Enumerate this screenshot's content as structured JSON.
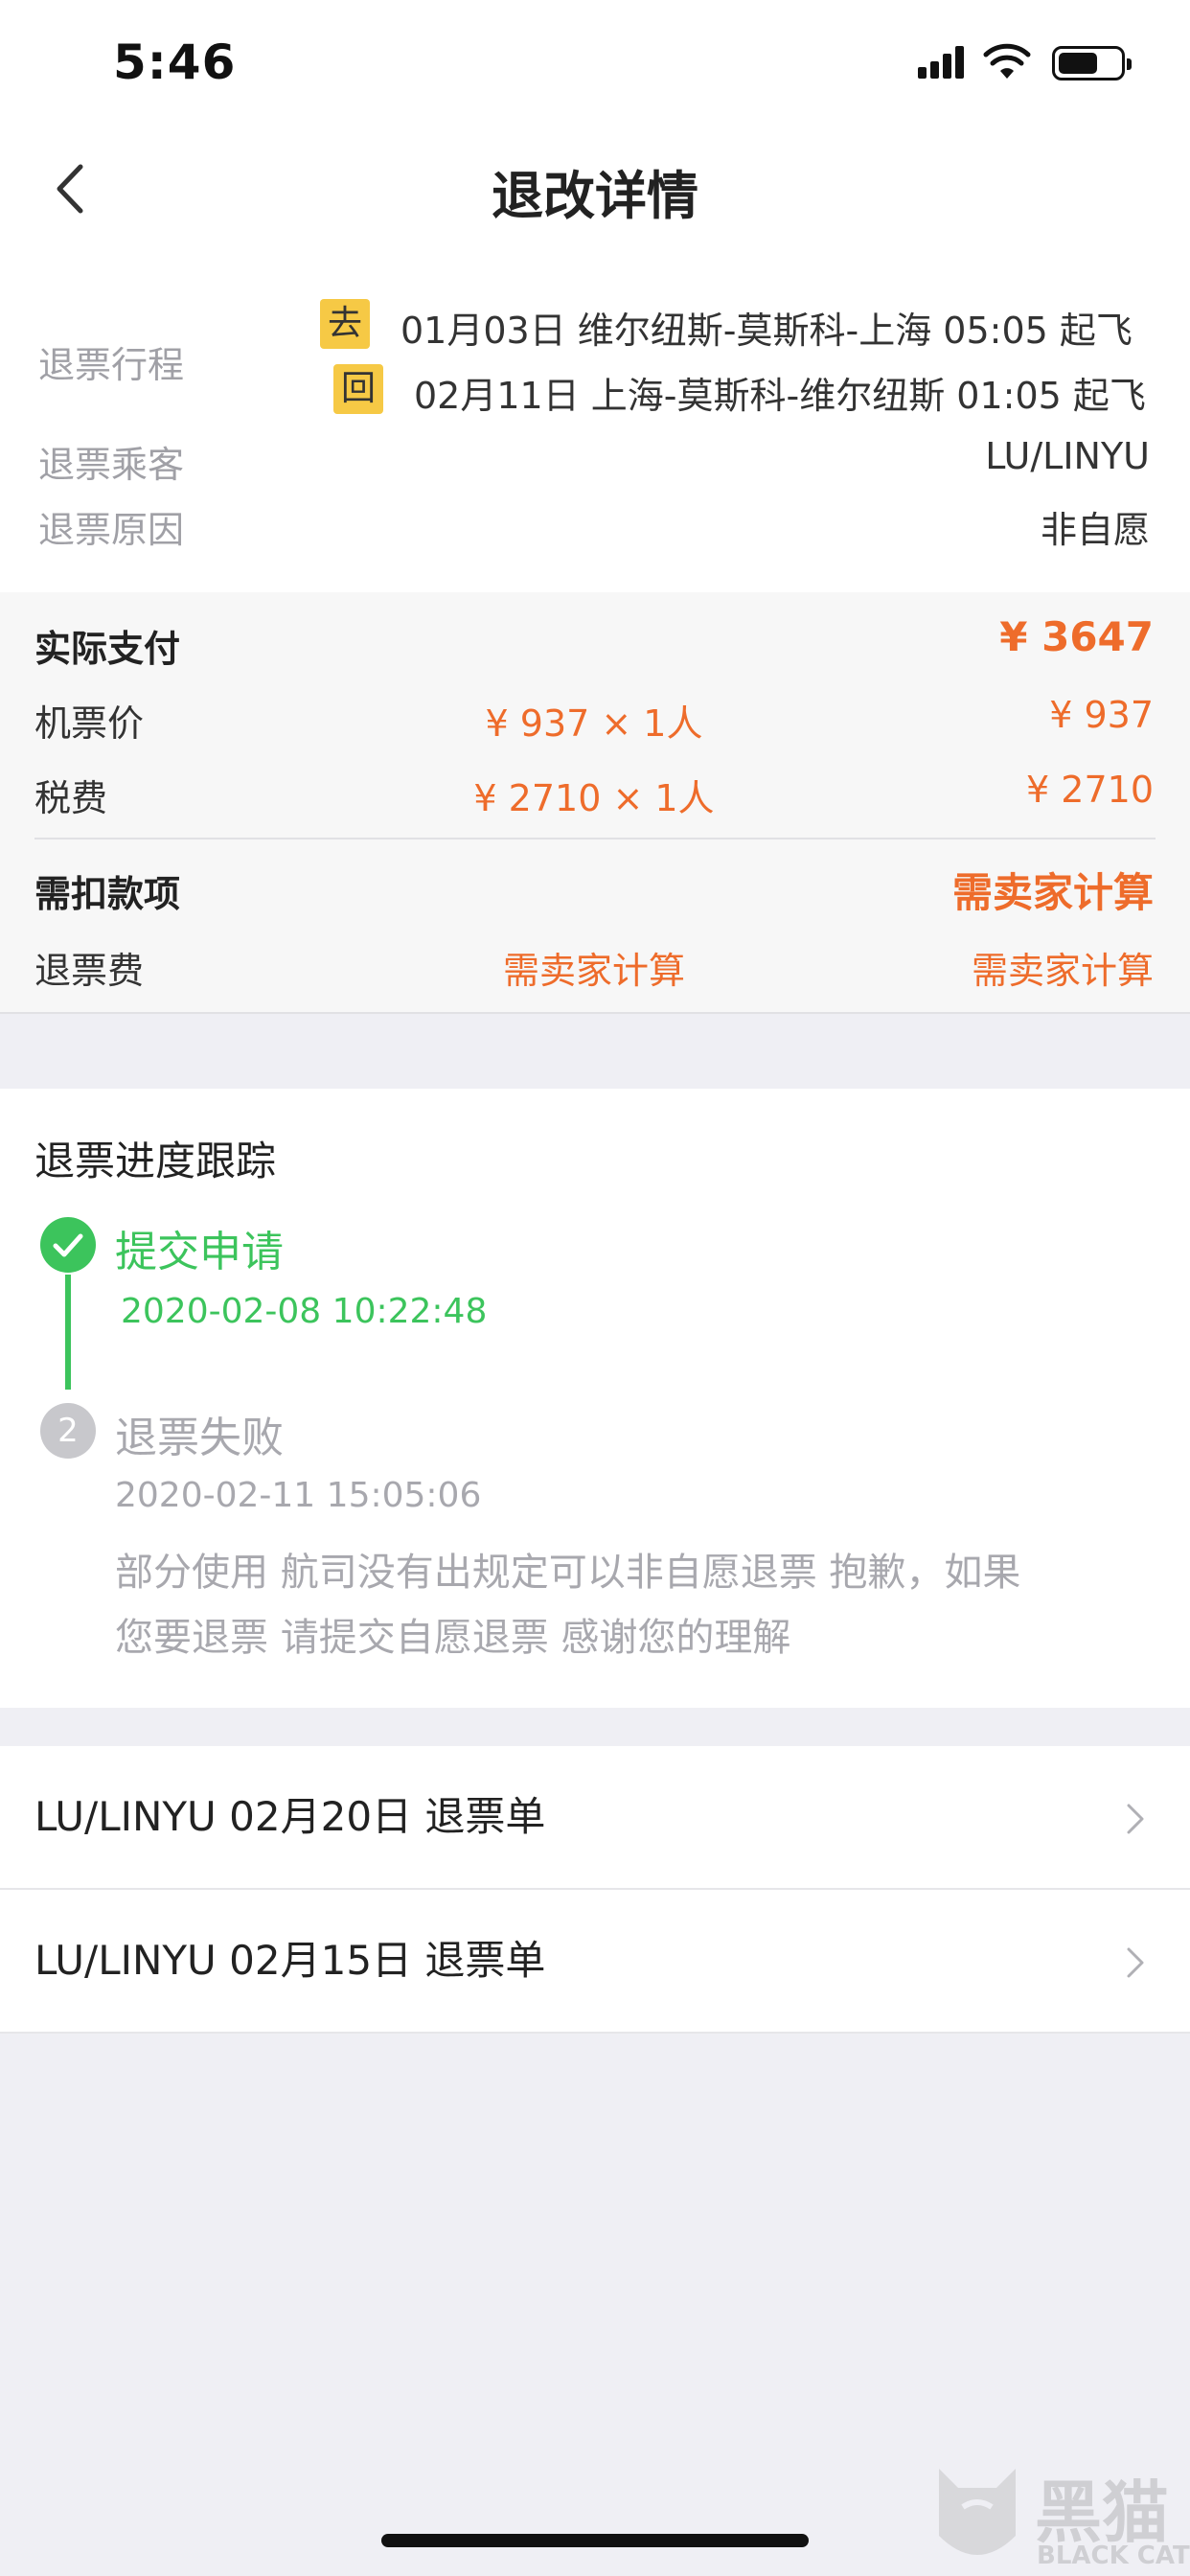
{
  "status_bar": {
    "time": "5:46"
  },
  "nav": {
    "title": "退改详情"
  },
  "refund": {
    "trip_label": "退票行程",
    "legs": [
      {
        "badge": "去",
        "text": "01月03日 维尔纽斯-莫斯科-上海 05:05 起飞"
      },
      {
        "badge": "回",
        "text": "02月11日 上海-莫斯科-维尔纽斯 01:05 起飞"
      }
    ],
    "passenger_label": "退票乘客",
    "passenger": "LU/LINYU",
    "reason_label": "退票原因",
    "reason": "非自愿"
  },
  "payment": {
    "actual_label": "实际支付",
    "actual_value": "¥ 3647",
    "rows": [
      {
        "label": "机票价",
        "unit": "¥ 937 × 1人",
        "total": "¥ 937"
      },
      {
        "label": "税费",
        "unit": "¥ 2710 × 1人",
        "total": "¥ 2710"
      }
    ],
    "deduct_label": "需扣款项",
    "deduct_value": "需卖家计算",
    "fee": {
      "label": "退票费",
      "unit": "需卖家计算",
      "total": "需卖家计算"
    }
  },
  "progress": {
    "title": "退票进度跟踪",
    "steps": [
      {
        "title": "提交申请",
        "time": "2020-02-08 10:22:48"
      },
      {
        "number": "2",
        "title": "退票失败",
        "time": "2020-02-11 15:05:06",
        "desc_line1": "部分使用 航司没有出规定可以非自愿退票 抱歉，如果",
        "desc_line2": "您要退票 请提交自愿退票 感谢您的理解"
      }
    ]
  },
  "orders": [
    {
      "label": "LU/LINYU 02月20日 退票单"
    },
    {
      "label": "LU/LINYU 02月15日 退票单"
    }
  ],
  "watermark": {
    "text": "黑猫",
    "sub": "BLACK CAT"
  },
  "colors": {
    "orange": "#ee6c2b",
    "green": "#3cc45c",
    "badge": "#f6c945"
  }
}
